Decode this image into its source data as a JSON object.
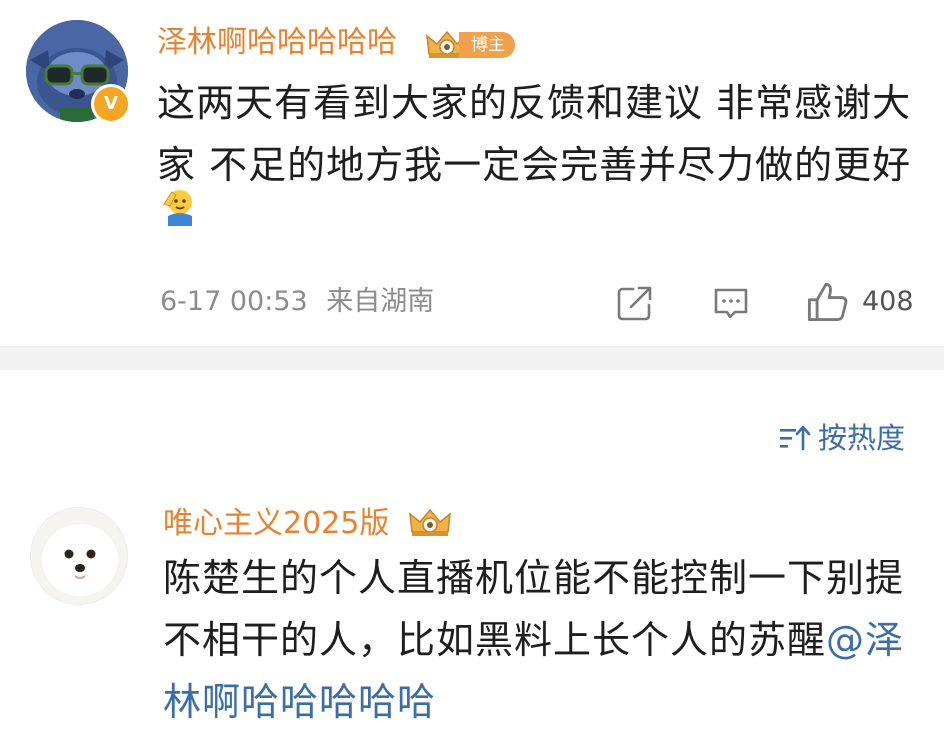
{
  "post": {
    "username": "泽林啊哈哈哈哈哈",
    "badge_label": "博主",
    "verified_mark": "V",
    "text": "这两天有看到大家的反馈和建议 非常感谢大家 不足的地方我一定会完善并尽力做的更好",
    "emoji": "salute-emoji",
    "timestamp": "6-17 00:53",
    "location": "来自湖南",
    "like_count": "408",
    "icons": [
      "share-icon",
      "comment-icon",
      "like-icon"
    ]
  },
  "sort": {
    "label": "按热度",
    "icon": "sort-icon"
  },
  "comment": {
    "username": "唯心主义2025版",
    "text_before_mention": "陈楚生的个人直播机位能不能控制一下别提不相干的人，比如黑料上长个人的苏醒",
    "mention": "@泽林啊哈哈哈哈哈"
  },
  "colors": {
    "username": "#e8822f",
    "link": "#3b6ea8",
    "badge": "#f0a14a",
    "meta": "#8c8c8c",
    "divider": "#f2f2f2"
  }
}
